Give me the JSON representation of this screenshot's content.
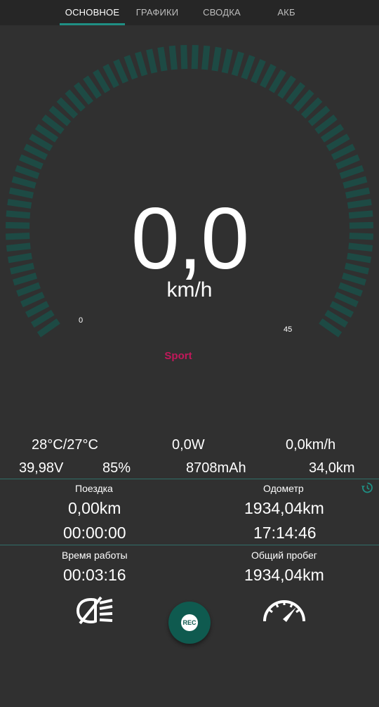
{
  "tabs": [
    {
      "label": "ОСНОВНОЕ",
      "active": true
    },
    {
      "label": "ГРАФИКИ",
      "active": false
    },
    {
      "label": "СВОДКА",
      "active": false
    },
    {
      "label": "АКБ",
      "active": false
    }
  ],
  "gauge": {
    "speed": "0,0",
    "unit": "km/h",
    "scale_min": "0",
    "scale_max": "45",
    "mode": "Sport",
    "tick_color": "#1d4a44"
  },
  "stats": {
    "temperature": "28°C/27°C",
    "power": "0,0W",
    "avg_speed": "0,0km/h",
    "voltage": "39,98V",
    "battery_percent": "85%",
    "capacity": "8708mAh",
    "range": "34,0km"
  },
  "trip": {
    "label": "Поездка",
    "distance": "0,00km",
    "time": "00:00:00"
  },
  "odometer": {
    "label": "Одометр",
    "distance": "1934,04km",
    "time": "17:14:46"
  },
  "uptime": {
    "label": "Время работы",
    "value": "00:03:16"
  },
  "total_mileage": {
    "label": "Общий пробег",
    "value": "1934,04km"
  },
  "rec_button": {
    "label": "REC"
  },
  "colors": {
    "accent": "#1f8f84",
    "mode": "#c2185b",
    "background": "#303030"
  }
}
